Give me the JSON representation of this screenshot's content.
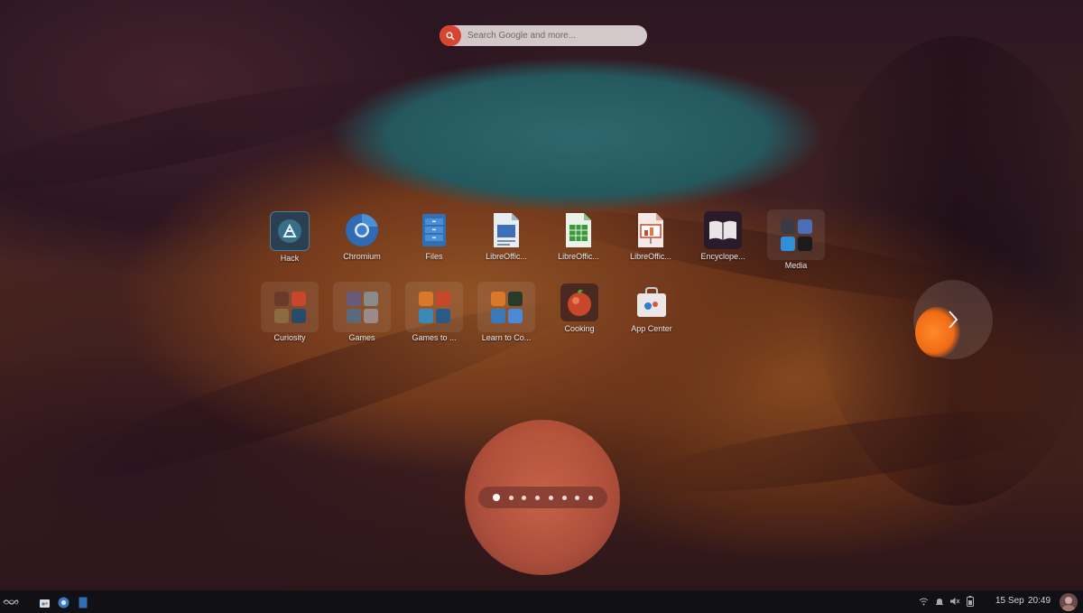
{
  "search": {
    "placeholder": "Search Google and more...",
    "icon": "search-icon"
  },
  "apps_row1": [
    {
      "label": "Hack",
      "icon": "hack-icon",
      "color": "#1e3a4e"
    },
    {
      "label": "Chromium",
      "icon": "chromium-icon",
      "color": "#3b78c9"
    },
    {
      "label": "Files",
      "icon": "files-icon",
      "color": "#2f6fb6"
    },
    {
      "label": "LibreOffic...",
      "icon": "libreoffice-writer-icon",
      "color": "#3d6fb6"
    },
    {
      "label": "LibreOffic...",
      "icon": "libreoffice-calc-icon",
      "color": "#3a9a3a"
    },
    {
      "label": "LibreOffic...",
      "icon": "libreoffice-impress-icon",
      "color": "#c94b2c"
    },
    {
      "label": "Encyclope...",
      "icon": "encyclopedia-icon",
      "color": "#2b1b2a"
    },
    {
      "label": "Media",
      "icon": "media-folder-icon"
    }
  ],
  "apps_row2": [
    {
      "label": "Curiosity",
      "icon": "curiosity-folder-icon"
    },
    {
      "label": "Games",
      "icon": "games-folder-icon"
    },
    {
      "label": "Games to ...",
      "icon": "games-to-create-folder-icon"
    },
    {
      "label": "Learn to Co...",
      "icon": "learn-to-code-folder-icon"
    },
    {
      "label": "Cooking",
      "icon": "cooking-icon",
      "color": "#c8462a"
    },
    {
      "label": "App Center",
      "icon": "app-center-icon",
      "color": "#e9e4e4"
    }
  ],
  "pager": {
    "pages": 8,
    "active": 1
  },
  "taskbar": {
    "date": "15 Sep",
    "time": "20:49",
    "launchers": [
      "endless-logo-icon",
      "app-center-taskbar-icon",
      "chromium-taskbar-icon",
      "files-taskbar-icon"
    ],
    "tray": [
      "network-icon",
      "notifications-icon",
      "volume-icon",
      "battery-icon",
      "user-avatar"
    ]
  }
}
